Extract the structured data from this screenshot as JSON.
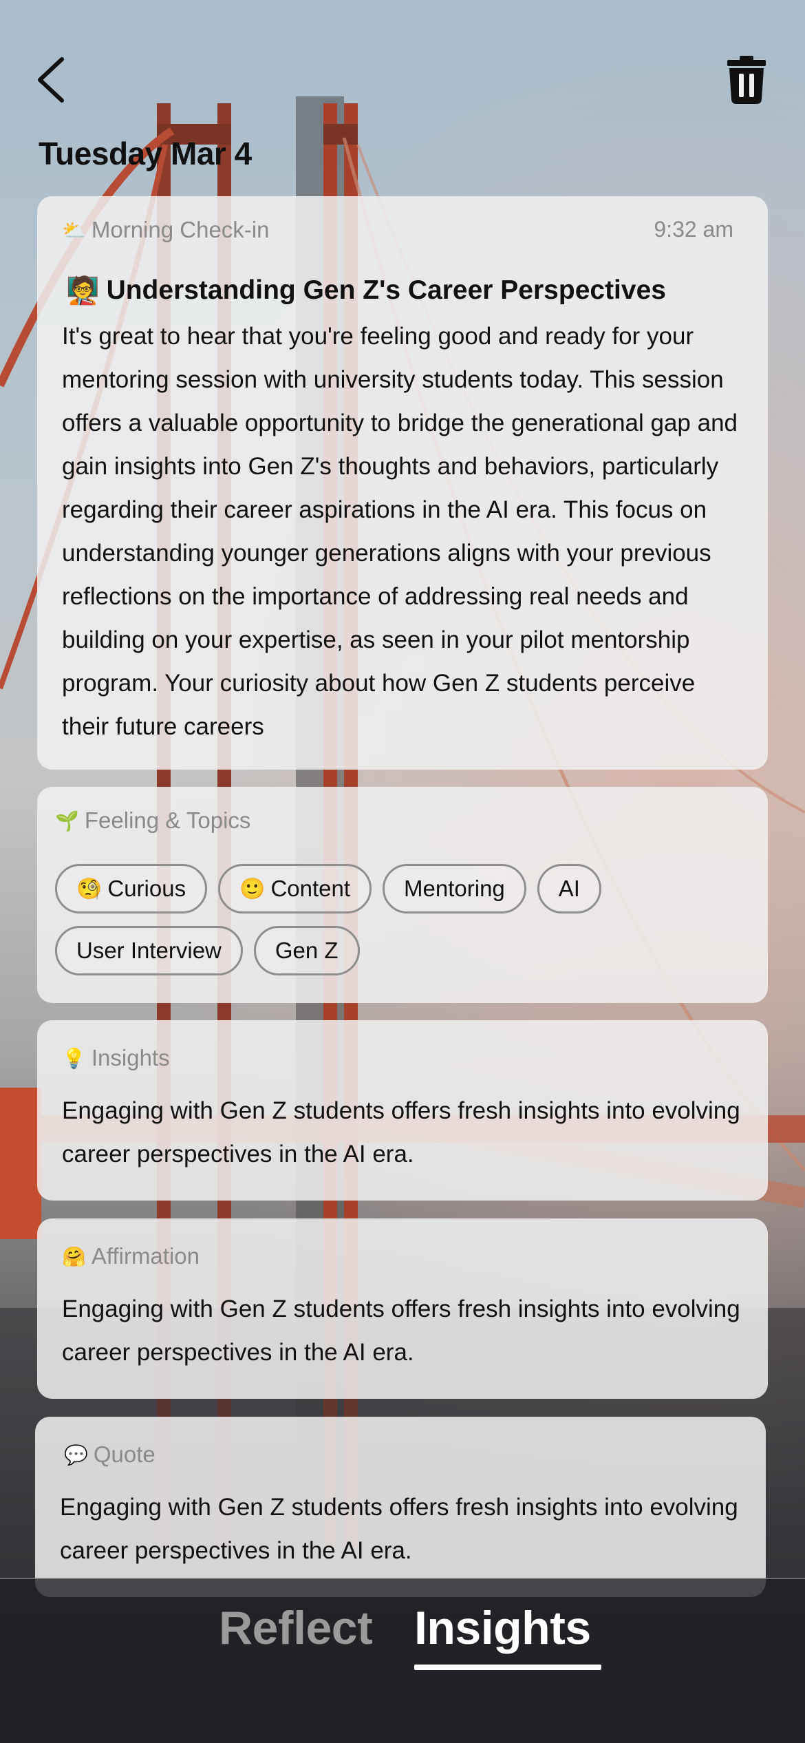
{
  "header": {
    "date_title": "Tuesday Mar 4",
    "back_icon": "chevron-left-icon",
    "delete_icon": "trash-icon"
  },
  "checkin_card": {
    "label": "Morning Check-in",
    "label_emoji": "⛅",
    "time": "9:32 am",
    "heading_emoji": "🧑‍🏫",
    "heading": "Understanding Gen Z's Career Perspectives",
    "body": "It's great to hear that you're feeling good and ready for your mentoring session with university students today. This session offers a valuable opportunity to bridge the generational gap and gain insights into Gen Z's thoughts and behaviors, particularly regarding their career aspirations in the AI era. This focus on understanding younger generations aligns with your previous reflections on the importance of addressing real needs and building on your expertise, as seen in your pilot mentorship program. Your curiosity about how Gen Z students perceive their future careers"
  },
  "topics_card": {
    "label": "Feeling & Topics",
    "label_emoji": "🌱",
    "chips": [
      {
        "emoji": "🧐",
        "label": "Curious"
      },
      {
        "emoji": "🙂",
        "label": "Content"
      },
      {
        "emoji": "",
        "label": "Mentoring"
      },
      {
        "emoji": "",
        "label": "AI"
      },
      {
        "emoji": "",
        "label": "User Interview"
      },
      {
        "emoji": "",
        "label": "Gen Z"
      }
    ]
  },
  "insights_card": {
    "label": "Insights",
    "label_emoji": "💡",
    "body": "Engaging with Gen Z students offers fresh insights into evolving career perspectives in the AI era."
  },
  "affirmation_card": {
    "label": "Affirmation",
    "label_emoji": "🤗",
    "body": "Engaging with Gen Z students offers fresh insights into evolving career perspectives in the AI era."
  },
  "quote_card": {
    "label": "Quote",
    "label_emoji": "💬",
    "body": "Engaging with Gen Z students offers fresh insights into evolving career perspectives in the AI era."
  },
  "tabs": [
    {
      "label": "Reflect",
      "active": false
    },
    {
      "label": "Insights",
      "active": true
    }
  ],
  "colors": {
    "card_bg": "#f0f0f0",
    "label_gray": "#8a8a8a",
    "text": "#111111",
    "tab_active": "#ffffff",
    "tab_inactive": "#9a9a9a",
    "bridge": "#b8472f"
  }
}
